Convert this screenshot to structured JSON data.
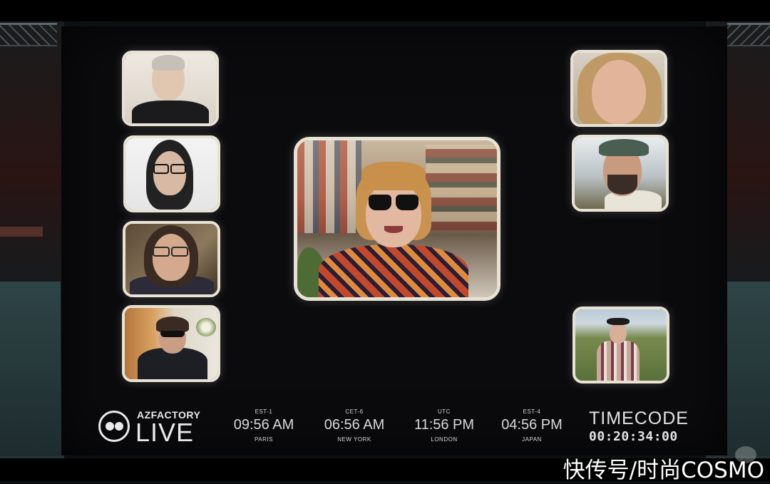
{
  "logo": {
    "brand_small": "AZFACTORY",
    "brand_large": "LIVE"
  },
  "clocks": [
    {
      "zone": "EST-1",
      "time": "09:56 AM",
      "city": "PARIS"
    },
    {
      "zone": "CET-6",
      "time": "06:56 AM",
      "city": "NEW YORK"
    },
    {
      "zone": "UTC",
      "time": "11:56 PM",
      "city": "LONDON"
    },
    {
      "zone": "EST-4",
      "time": "04:56 PM",
      "city": "JAPAN"
    }
  ],
  "timecode": {
    "label": "TIMECODE",
    "value": "00:20:34:00"
  },
  "watermark": "快传号/时尚COSMO",
  "colors": {
    "tile_border": "#e8e2d4",
    "screen_bg": "#0b0b0e",
    "text": "#e9e9e9"
  }
}
